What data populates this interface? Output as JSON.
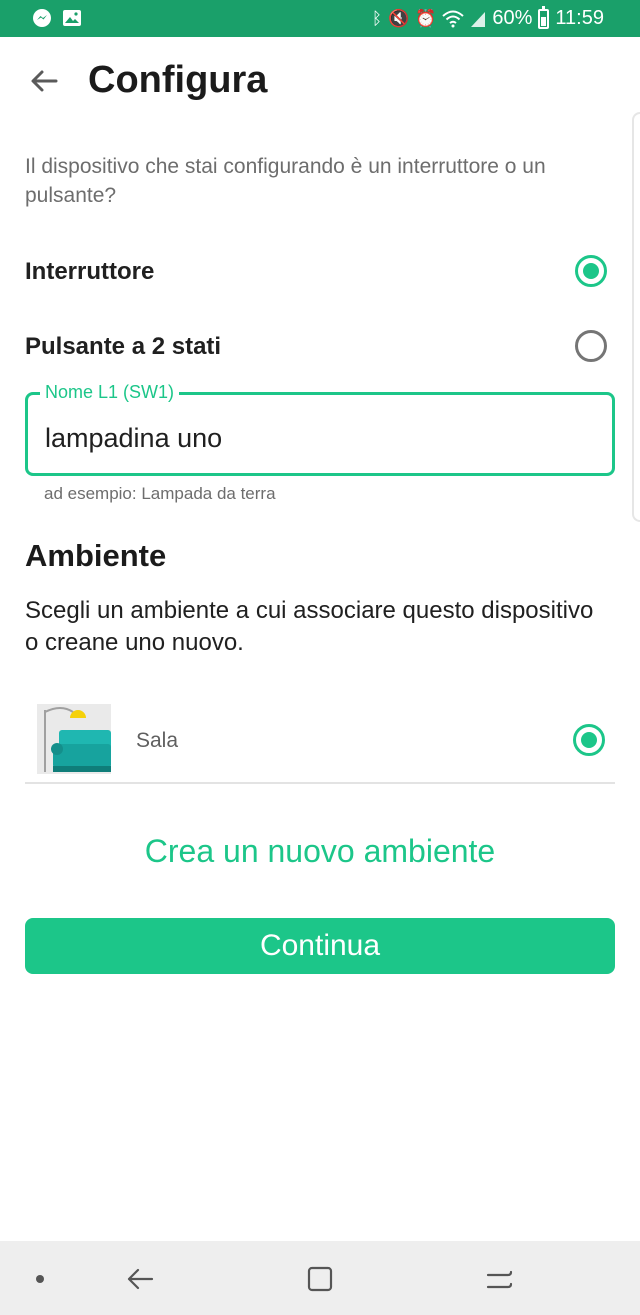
{
  "status_bar": {
    "battery": "60%",
    "time": "11:59",
    "left_icons": [
      "messenger-icon",
      "image-icon"
    ],
    "right_icons": [
      "bluetooth-icon",
      "mute-icon",
      "alarm-icon",
      "wifi-icon",
      "signal-icon",
      "battery-icon"
    ]
  },
  "header": {
    "title": "Configura",
    "back_icon": "arrow-back-icon"
  },
  "question": "Il dispositivo che stai configurando è un interruttore o un pulsante?",
  "options": [
    {
      "label": "Interruttore",
      "selected": true
    },
    {
      "label": "Pulsante a 2 stati",
      "selected": false
    }
  ],
  "name_field": {
    "label": "Nome L1 (SW1)",
    "value": "lampadina uno",
    "helper": "ad esempio: Lampada da terra"
  },
  "ambiente": {
    "title": "Ambiente",
    "description": "Scegli un ambiente a cui associare questo dispositivo o creane uno nuovo.",
    "rooms": [
      {
        "name": "Sala",
        "icon": "living-room-sofa-icon",
        "selected": true
      }
    ],
    "create_label": "Crea un nuovo ambiente"
  },
  "continue_label": "Continua",
  "colors": {
    "accent": "#1cc689",
    "status_bar": "#1aa06a",
    "text_primary": "#1b1b1b",
    "text_secondary": "#6d6d6d"
  },
  "nav_bar": {
    "icons": [
      "dot-icon",
      "nav-back-icon",
      "recents-icon",
      "multitask-icon"
    ]
  }
}
